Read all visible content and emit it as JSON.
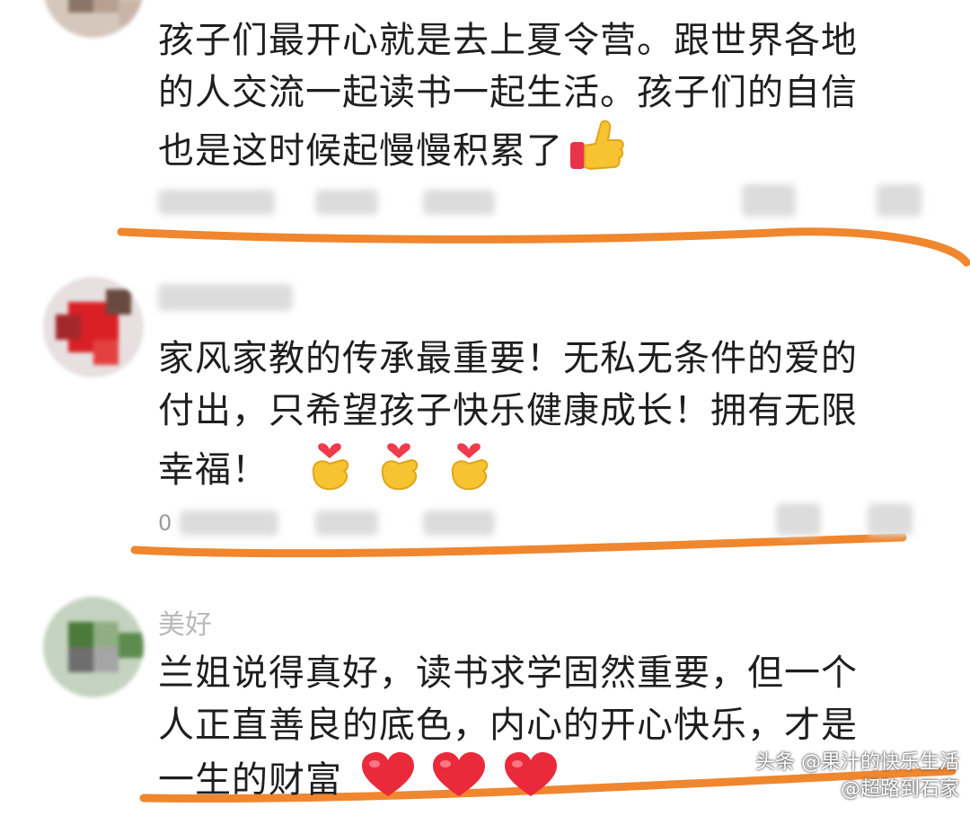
{
  "comments": [
    {
      "username": "",
      "text_lines": [
        "孩子们最开心就是去上夏令营。跟世界各地",
        "的人交流一起读书一起生活。孩子们的自信",
        "也是这时候起慢慢积累了"
      ],
      "emoji": "thumbs-up-icon",
      "meta_text": ""
    },
    {
      "username": "",
      "text_lines": [
        "家风家教的传承最重要！无私无条件的爱的",
        "付出，只希望孩子快乐健康成长！拥有无限",
        "幸福！"
      ],
      "emoji": "finger-heart-icon",
      "meta_text": "0"
    },
    {
      "username": "美好",
      "text_lines": [
        "兰姐说得真好，读书求学固然重要，但一个",
        "人正直善良的底色，内心的开心快乐，才是",
        "一生的财富"
      ],
      "emoji": "red-heart-icon",
      "meta_text": ""
    }
  ],
  "watermark": {
    "line1": "头条 @果汁的快乐生活",
    "line2": "@超路到石家"
  },
  "colors": {
    "underline": "#f0862e",
    "text": "#1e1e1e",
    "muted": "#b9b9b9"
  }
}
